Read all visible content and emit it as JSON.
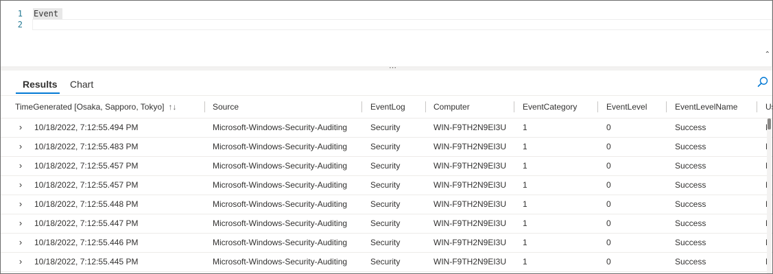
{
  "editor": {
    "lines": [
      {
        "number": "1",
        "text": "Event"
      },
      {
        "number": "2",
        "text": ""
      }
    ],
    "collapse_glyph": "⌃"
  },
  "splitter": {
    "grip": "⋯"
  },
  "tabs": [
    {
      "label": "Results",
      "active": true
    },
    {
      "label": "Chart",
      "active": false
    }
  ],
  "accent_color": "#0078d4",
  "search": {
    "icon": "search-icon"
  },
  "table": {
    "columns": [
      "TimeGenerated [Osaka, Sapporo, Tokyo]",
      "Source",
      "EventLog",
      "Computer",
      "EventCategory",
      "EventLevel",
      "EventLevelName",
      "Us"
    ],
    "sort_glyph": "↑↓",
    "expand_glyph": "›",
    "rows": [
      [
        "10/18/2022, 7:12:55.494 PM",
        "Microsoft-Windows-Security-Auditing",
        "Security",
        "WIN-F9TH2N9EI3U",
        "1",
        "0",
        "Success",
        "N"
      ],
      [
        "10/18/2022, 7:12:55.483 PM",
        "Microsoft-Windows-Security-Auditing",
        "Security",
        "WIN-F9TH2N9EI3U",
        "1",
        "0",
        "Success",
        "N"
      ],
      [
        "10/18/2022, 7:12:55.457 PM",
        "Microsoft-Windows-Security-Auditing",
        "Security",
        "WIN-F9TH2N9EI3U",
        "1",
        "0",
        "Success",
        "N"
      ],
      [
        "10/18/2022, 7:12:55.457 PM",
        "Microsoft-Windows-Security-Auditing",
        "Security",
        "WIN-F9TH2N9EI3U",
        "1",
        "0",
        "Success",
        "N"
      ],
      [
        "10/18/2022, 7:12:55.448 PM",
        "Microsoft-Windows-Security-Auditing",
        "Security",
        "WIN-F9TH2N9EI3U",
        "1",
        "0",
        "Success",
        "N"
      ],
      [
        "10/18/2022, 7:12:55.447 PM",
        "Microsoft-Windows-Security-Auditing",
        "Security",
        "WIN-F9TH2N9EI3U",
        "1",
        "0",
        "Success",
        "N"
      ],
      [
        "10/18/2022, 7:12:55.446 PM",
        "Microsoft-Windows-Security-Auditing",
        "Security",
        "WIN-F9TH2N9EI3U",
        "1",
        "0",
        "Success",
        "N"
      ],
      [
        "10/18/2022, 7:12:55.445 PM",
        "Microsoft-Windows-Security-Auditing",
        "Security",
        "WIN-F9TH2N9EI3U",
        "1",
        "0",
        "Success",
        "N"
      ]
    ]
  }
}
